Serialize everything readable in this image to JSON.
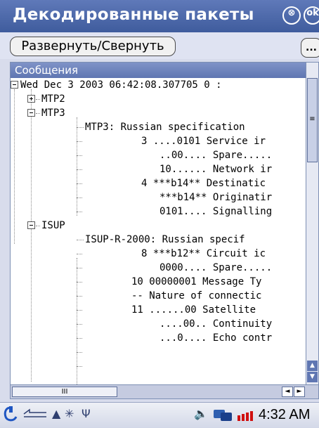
{
  "window": {
    "title": "Декодированные пакеты",
    "close_icon": "⊗",
    "ok_label": "ok"
  },
  "toolbar": {
    "expand_collapse_label": "Развернуть/Свернуть",
    "more_label": "..."
  },
  "panel": {
    "header": "Сообщения",
    "tree_rows": [
      "Wed Dec 3 2003 06:42:08.307705 0 :",
      "MTP2",
      "MTP3",
      "MTP3: Russian specification",
      "3 ....0101 Service ir",
      "..00.... Spare.....",
      "10...... Network ir",
      "4 ***b14** Destinatic",
      "***b14** Originatir",
      "0101.... Signalling",
      "ISUP",
      "ISUP-R-2000: Russian specif",
      "8 ***b12** Circuit ic",
      "0000.... Spare.....",
      "10 00000001 Message Ty",
      "-- Nature of connectic",
      "11 ......00 Satellite",
      "....00.. Continuity",
      "...0.... Echo contr"
    ]
  },
  "scrollbar": {
    "vertical_thumb_glyph": "≡",
    "horizontal_thumb_glyph": "III",
    "left_arrow": "◄",
    "right_arrow": "►",
    "up_arrow": "▲",
    "down_arrow": "▼"
  },
  "taskbar": {
    "start_icon": "start-icon",
    "clock": "4:32 AM",
    "tray_icons": [
      "connectivity-icon",
      "arrow-up-icon",
      "sync-icon",
      "antenna-icon",
      "volume-icon",
      "network-icon",
      "battery-icon"
    ]
  }
}
